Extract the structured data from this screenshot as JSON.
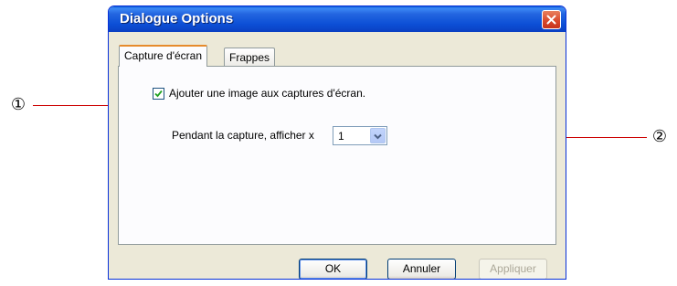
{
  "window": {
    "title": "Dialogue Options"
  },
  "tabs": [
    {
      "label": "Capture d'écran",
      "active": true
    },
    {
      "label": "Frappes",
      "active": false
    }
  ],
  "capture_tab": {
    "checkbox_label": "Ajouter une image aux captures d'écran.",
    "checkbox_checked": true,
    "zoom_label": "Pendant la capture, afficher x",
    "zoom_value": "1"
  },
  "buttons": {
    "ok": "OK",
    "cancel": "Annuler",
    "apply": "Appliquer"
  },
  "callouts": {
    "one": "①",
    "two": "②"
  },
  "colors": {
    "callout_line": "#cc0000",
    "titlebar": "#0c4fd6",
    "close_button": "#d8462a"
  },
  "icons": [
    "close-icon",
    "checkmark-icon",
    "chevron-down-icon"
  ]
}
